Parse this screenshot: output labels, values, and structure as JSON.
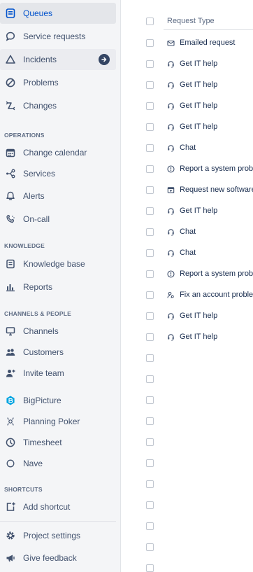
{
  "sidebar": {
    "queues": "Queues",
    "service_requests": "Service requests",
    "incidents": "Incidents",
    "problems": "Problems",
    "changes": "Changes",
    "operations_header": "OPERATIONS",
    "change_calendar": "Change calendar",
    "services": "Services",
    "alerts": "Alerts",
    "on_call": "On-call",
    "knowledge_header": "KNOWLEDGE",
    "knowledge_base": "Knowledge base",
    "reports": "Reports",
    "channels_header": "CHANNELS & PEOPLE",
    "channels": "Channels",
    "customers": "Customers",
    "invite_team": "Invite team",
    "bigpicture": "BigPicture",
    "planning_poker": "Planning Poker",
    "timesheet": "Timesheet",
    "nave": "Nave",
    "shortcuts_header": "SHORTCUTS",
    "add_shortcut": "Add shortcut",
    "project_settings": "Project settings",
    "give_feedback": "Give feedback"
  },
  "table": {
    "column_header": "Request Type",
    "rows": [
      {
        "type": "Emailed request",
        "icon": "envelope-icon"
      },
      {
        "type": "Get IT help",
        "icon": "headset-icon"
      },
      {
        "type": "Get IT help",
        "icon": "headset-icon"
      },
      {
        "type": "Get IT help",
        "icon": "headset-icon"
      },
      {
        "type": "Get IT help",
        "icon": "headset-icon"
      },
      {
        "type": "Chat",
        "icon": "headset-icon"
      },
      {
        "type": "Report a system proble",
        "icon": "alert-circle-icon"
      },
      {
        "type": "Request new software",
        "icon": "software-box-icon"
      },
      {
        "type": "Get IT help",
        "icon": "headset-icon"
      },
      {
        "type": "Chat",
        "icon": "headset-icon"
      },
      {
        "type": "Chat",
        "icon": "headset-icon"
      },
      {
        "type": "Report a system proble",
        "icon": "alert-circle-icon"
      },
      {
        "type": "Fix an account problem",
        "icon": "user-key-icon"
      },
      {
        "type": "Get IT help",
        "icon": "headset-icon"
      },
      {
        "type": "Get IT help",
        "icon": "headset-icon"
      }
    ]
  },
  "colors": {
    "accent": "#0052cc",
    "sidebar_bg": "#f4f5f7",
    "selected_bg": "#e4e6ea",
    "text": "#42526e",
    "bigpicture_brand": "#00a3e0"
  }
}
